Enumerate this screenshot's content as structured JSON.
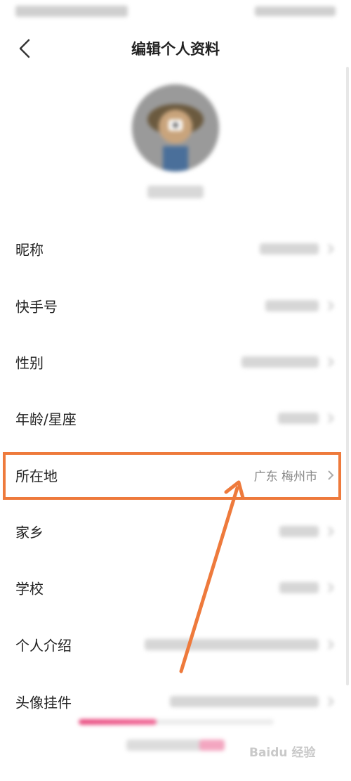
{
  "header": {
    "title": "编辑个人资料"
  },
  "rows": [
    {
      "label": "昵称"
    },
    {
      "label": "快手号"
    },
    {
      "label": "性别"
    },
    {
      "label": "年龄/星座"
    },
    {
      "label": "所在地",
      "value": "广东 梅州市"
    },
    {
      "label": "家乡"
    },
    {
      "label": "学校"
    },
    {
      "label": "个人介绍"
    },
    {
      "label": "头像挂件"
    }
  ],
  "colors": {
    "highlight": "#ee7a3c",
    "accent": "#e84a7e"
  },
  "icons": [
    "back-icon",
    "avatar-camera-icon",
    "chevron-right-icon"
  ],
  "watermark": {
    "text": "Baidu 经验"
  },
  "profile_progress": 0.4
}
